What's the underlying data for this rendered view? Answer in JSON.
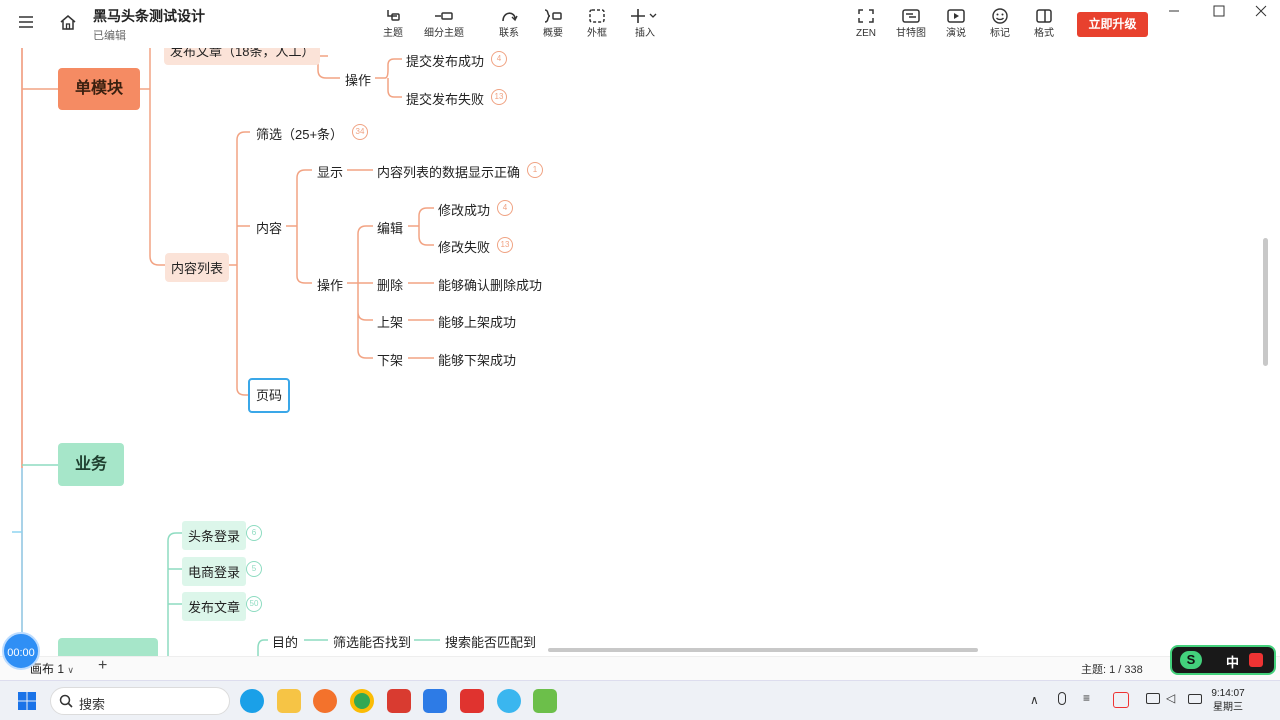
{
  "titlebar": {
    "doc_title": "黑马头条测试设计",
    "doc_status": "已编辑",
    "tools": [
      {
        "label": "主题",
        "icon": "topic-icon"
      },
      {
        "label": "细分主题",
        "icon": "subtopic-icon"
      },
      {
        "label": "联系",
        "icon": "relation-icon"
      },
      {
        "label": "概要",
        "icon": "summary-icon"
      },
      {
        "label": "外框",
        "icon": "boundary-icon"
      },
      {
        "label": "插入",
        "icon": "insert-icon"
      }
    ],
    "right_tools": [
      {
        "label": "ZEN",
        "icon": "zen-icon"
      },
      {
        "label": "甘特图",
        "icon": "gantt-icon"
      },
      {
        "label": "演说",
        "icon": "pitch-icon"
      },
      {
        "label": "标记",
        "icon": "marker-icon"
      },
      {
        "label": "格式",
        "icon": "format-icon"
      }
    ],
    "upgrade_label": "立即升级"
  },
  "mindmap": {
    "top_cut": "发布文章（18条，人工）",
    "single_module": "单模块",
    "op_1": "操作",
    "submit_ok": "提交发布成功",
    "submit_ok_badge": "4",
    "submit_fail": "提交发布失败",
    "submit_fail_badge": "13",
    "filter": "筛选（25+条）",
    "filter_badge": "34",
    "content_list": "内容列表",
    "content": "内容",
    "display": "显示",
    "display_correct": "内容列表的数据显示正确",
    "display_correct_badge": "1",
    "op_2": "操作",
    "edit": "编辑",
    "edit_ok": "修改成功",
    "edit_ok_badge": "4",
    "edit_fail": "修改失败",
    "edit_fail_badge": "13",
    "delete": "删除",
    "delete_ok": "能够确认删除成功",
    "up_shelf": "上架",
    "up_ok": "能够上架成功",
    "down_shelf": "下架",
    "down_ok": "能够下架成功",
    "pagination": "页码",
    "business": "业务",
    "login_toutiao": "头条登录",
    "login_toutiao_badge": "6",
    "login_ecom": "电商登录",
    "login_ecom_badge": "5",
    "publish_article": "发布文章",
    "publish_article_badge": "50",
    "purpose": "目的",
    "filter_find": "筛选能否找到",
    "search_match": "搜索能否匹配到"
  },
  "statusbar": {
    "timer": "00:00",
    "canvas_tab": "画布 1",
    "add_canvas": "+",
    "topic_count": "主题: 1 / 338",
    "ime_label": "中"
  },
  "taskbar": {
    "search_placeholder": "搜索",
    "time": "9:14:07",
    "weekday": "星期三"
  },
  "colors": {
    "accent_orange": "#f58b63",
    "accent_green": "#a6e6c9",
    "upgrade_red": "#e8412e",
    "select_blue": "#3aa7e8"
  }
}
